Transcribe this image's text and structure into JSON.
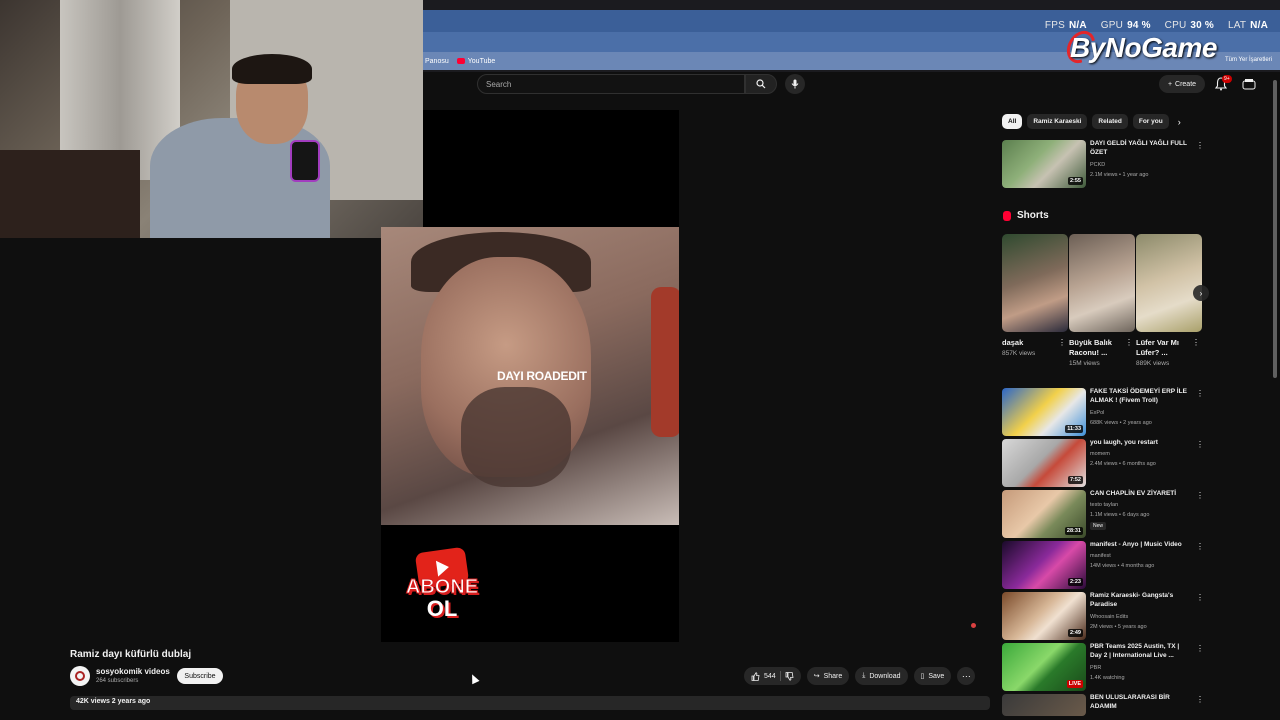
{
  "browser": {
    "bookmarks": [
      {
        "label": "Panosu"
      },
      {
        "label": "YouTube"
      }
    ],
    "bookmarks_right": "Tüm Yer İşaretleri"
  },
  "overlay": {
    "fps_label": "FPS",
    "fps_value": "N/A",
    "gpu_label": "GPU",
    "gpu_value": "94 %",
    "cpu_label": "CPU",
    "cpu_value": "30 %",
    "lat_label": "LAT",
    "lat_value": "N/A",
    "brand": "ByNoGame",
    "accent_color": "#e3262b"
  },
  "youtube": {
    "search_placeholder": "Search",
    "create_label": "Create",
    "notif_count": "9+"
  },
  "video": {
    "watermark": "DAYI ROADEDIT",
    "abone_line1": "ABONE",
    "abone_line2": "OL",
    "title": "Ramiz dayı küfürlü dublaj",
    "channel": "sosyokomik videos",
    "subscribers": "264 subscribers",
    "subscribe_label": "Subscribe",
    "likes": "544",
    "share_label": "Share",
    "download_label": "Download",
    "save_label": "Save",
    "views_date": "42K views  2 years ago"
  },
  "sidebar": {
    "chips": [
      {
        "label": "All",
        "active": true
      },
      {
        "label": "Ramiz Karaeski",
        "active": false
      },
      {
        "label": "Related",
        "active": false
      },
      {
        "label": "For you",
        "active": false
      }
    ],
    "top_rec": {
      "title": "DAYI GELDİ YAĞLI YAĞLI FULL ÖZET",
      "channel": "PCKD",
      "meta": "2.1M views • 1 year ago",
      "duration": "2:55"
    },
    "shorts_heading": "Shorts",
    "shorts": [
      {
        "title": "daşak",
        "views": "857K views"
      },
      {
        "title": "Büyük Balık Raconu! ...",
        "views": "15M views"
      },
      {
        "title": "Lüfer Var Mı Lüfer? ...",
        "views": "889K views"
      }
    ],
    "recs": [
      {
        "title": "FAKE TAKSİ ÖDEMEYİ ERP İLE ALMAK ! (Fivem Troll)",
        "channel": "ExPol",
        "meta": "688K views • 2 years ago",
        "duration": "11:33",
        "new": ""
      },
      {
        "title": "you laugh, you restart",
        "channel": "momem",
        "meta": "2.4M views • 6 months ago",
        "duration": "7:52",
        "new": ""
      },
      {
        "title": "CAN CHAPLİN EV ZİYARETİ",
        "channel": "testo taylan",
        "meta": "1.1M views • 6 days ago",
        "duration": "28:31",
        "new": "New"
      },
      {
        "title": "manifest - Anyo | Music Video",
        "channel": "manifest",
        "meta": "14M views • 4 months ago",
        "duration": "2:23",
        "new": ""
      },
      {
        "title": "Ramiz Karaeski- Gangsta's Paradise",
        "channel": "Whoosain Edits",
        "meta": "2M views • 5 years ago",
        "duration": "2:49",
        "new": ""
      },
      {
        "title": "PBR Teams 2025 Austin, TX | Day 2 | International Live ...",
        "channel": "PBR",
        "meta": "1.4K watching",
        "duration": "LIVE",
        "new": ""
      },
      {
        "title": "BEN ULUSLARARASI BİR ADAMIM",
        "channel": "",
        "meta": "",
        "duration": "",
        "new": ""
      }
    ]
  }
}
